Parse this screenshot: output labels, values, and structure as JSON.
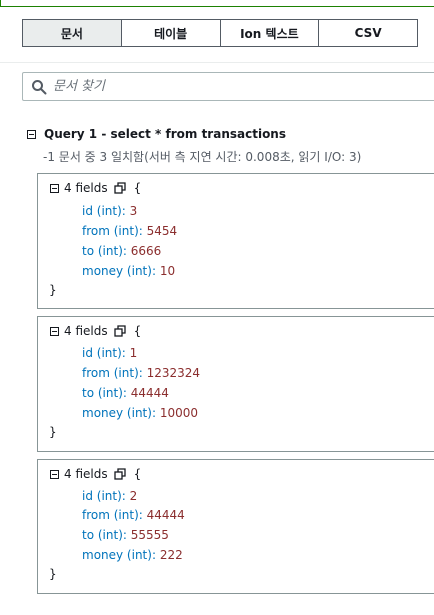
{
  "tabs": [
    {
      "label": "문서",
      "active": true
    },
    {
      "label": "테이블",
      "active": false
    },
    {
      "label": "Ion 텍스트",
      "active": false
    },
    {
      "label": "CSV",
      "active": false
    }
  ],
  "search": {
    "placeholder": "문서 찾기",
    "icon": "search-icon"
  },
  "query": {
    "title": "Query 1 - select * from transactions",
    "meta": "-1 문서 중 3 일치함(서버 측 지연 시간: 0.008초, 읽기 I/O: 3)"
  },
  "documents": [
    {
      "fields_label": "4 fields",
      "brace_open": "{",
      "brace_close": "}",
      "fields": [
        {
          "key": "id (int):",
          "value": "3"
        },
        {
          "key": "from (int):",
          "value": "5454"
        },
        {
          "key": "to (int):",
          "value": "6666"
        },
        {
          "key": "money (int):",
          "value": "10"
        }
      ]
    },
    {
      "fields_label": "4 fields",
      "brace_open": "{",
      "brace_close": "}",
      "fields": [
        {
          "key": "id (int):",
          "value": "1"
        },
        {
          "key": "from (int):",
          "value": "1232324"
        },
        {
          "key": "to (int):",
          "value": "44444"
        },
        {
          "key": "money (int):",
          "value": "10000"
        }
      ]
    },
    {
      "fields_label": "4 fields",
      "brace_open": "{",
      "brace_close": "}",
      "fields": [
        {
          "key": "id (int):",
          "value": "2"
        },
        {
          "key": "from (int):",
          "value": "44444"
        },
        {
          "key": "to (int):",
          "value": "55555"
        },
        {
          "key": "money (int):",
          "value": "222"
        }
      ]
    }
  ],
  "colors": {
    "success_border": "#1d8102",
    "key": "#0073bb",
    "value": "#8b2e2e"
  }
}
